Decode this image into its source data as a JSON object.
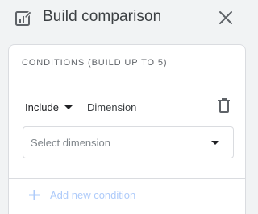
{
  "header": {
    "title": "Build comparison",
    "icon": "edit-chart-icon",
    "close_icon": "close-icon"
  },
  "conditions": {
    "heading": "CONDITIONS (BUILD UP TO 5)",
    "rows": [
      {
        "mode": "Include",
        "type_label": "Dimension",
        "select_placeholder": "Select dimension"
      }
    ],
    "add_label": "Add new condition"
  },
  "colors": {
    "background": "#f1f3f4",
    "card": "#ffffff",
    "border": "#dadce0",
    "disabled_accent": "#aecbfa"
  }
}
